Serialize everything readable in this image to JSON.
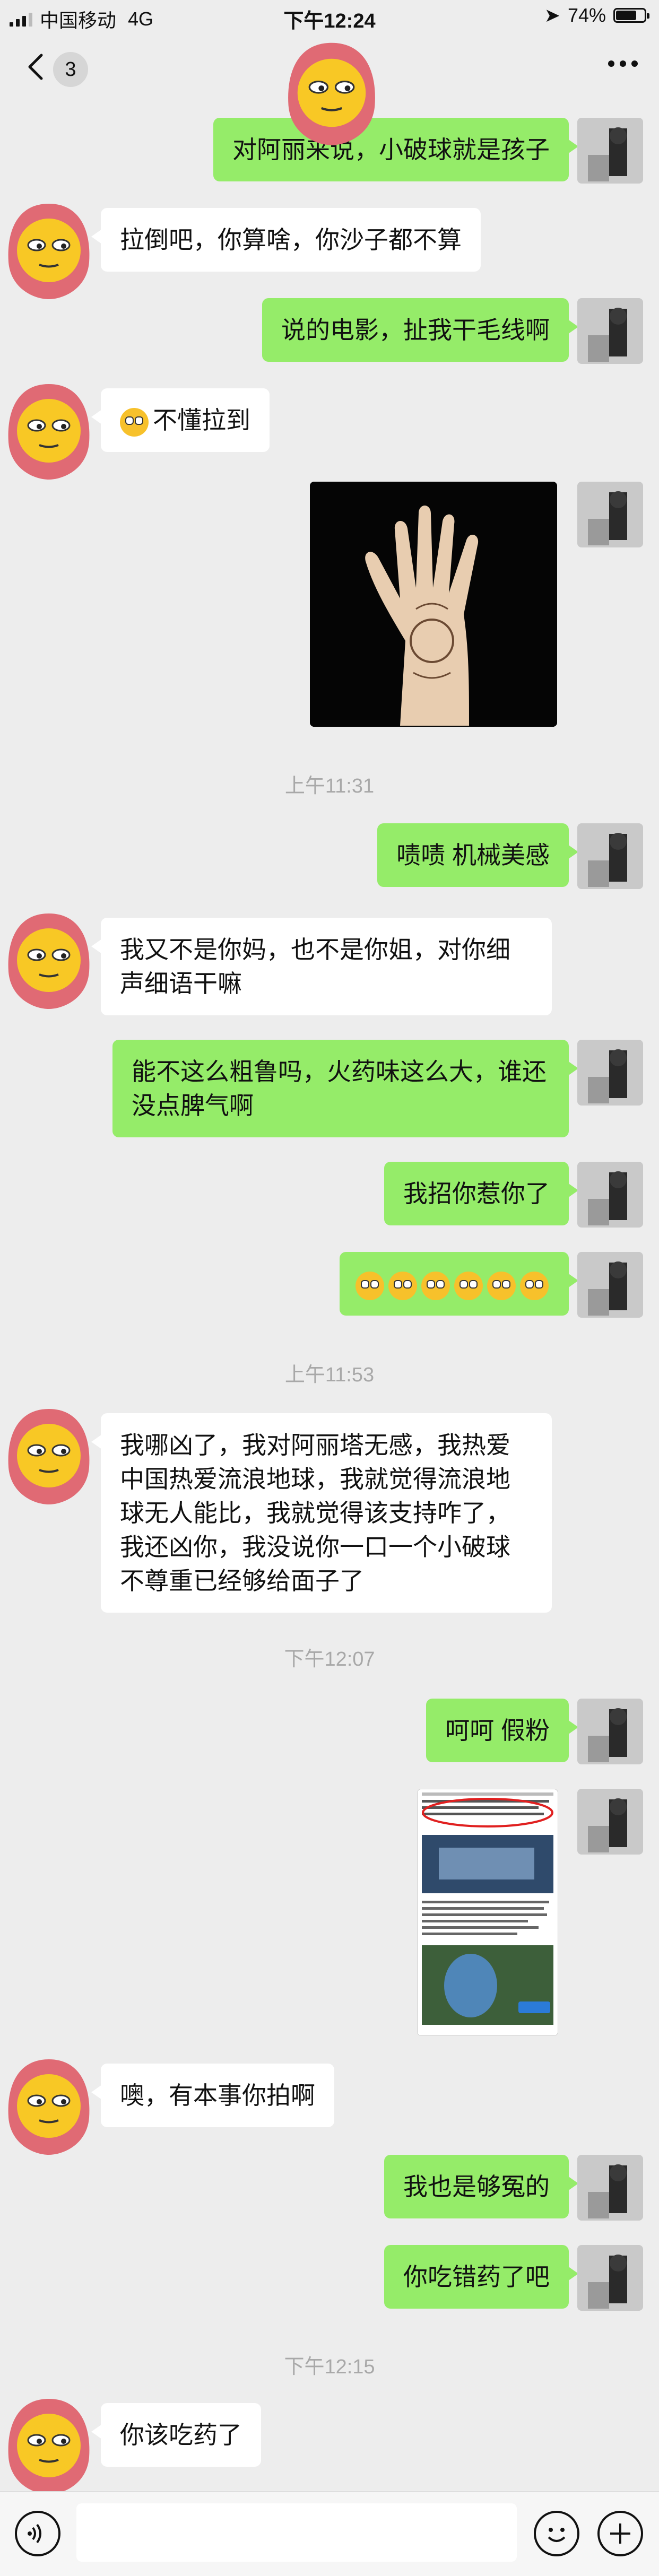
{
  "status_bar": {
    "carrier": "中国移动",
    "network": "4G",
    "time": "下午12:24",
    "battery_pct": "74%",
    "battery_level": 0.74
  },
  "nav": {
    "unread_count": "3"
  },
  "messages": [
    {
      "id": "m1",
      "text": "对阿丽来说，小破球就是孩子"
    },
    {
      "id": "m2",
      "text": "拉倒吧，你算啥，你沙子都不算"
    },
    {
      "id": "m3",
      "text": "说的电影，扯我干毛线啊"
    },
    {
      "id": "m4",
      "text": "不懂拉到"
    },
    {
      "id": "ts1",
      "text": "上午11:31"
    },
    {
      "id": "m5",
      "text": "啧啧 机械美感"
    },
    {
      "id": "m6",
      "text": "我又不是你妈，也不是你姐，对你细声细语干嘛"
    },
    {
      "id": "m7",
      "text": "能不这么粗鲁吗，火药味这么大，谁还没点脾气啊"
    },
    {
      "id": "m8",
      "text": "我招你惹你了"
    },
    {
      "id": "ts2",
      "text": "上午11:53"
    },
    {
      "id": "m10",
      "text": "我哪凶了，我对阿丽塔无感，我热爱中国热爱流浪地球，我就觉得流浪地球无人能比，我就觉得该支持咋了，我还凶你，我没说你一口一个小破球不尊重已经够给面子了"
    },
    {
      "id": "ts3",
      "text": "下午12:07"
    },
    {
      "id": "m11",
      "text": "呵呵 假粉"
    },
    {
      "id": "m13",
      "text": "噢，有本事你拍啊"
    },
    {
      "id": "m14",
      "text": "我也是够冤的"
    },
    {
      "id": "m15",
      "text": "你吃错药了吧"
    },
    {
      "id": "ts4",
      "text": "下午12:15"
    },
    {
      "id": "m16",
      "text": "你该吃药了"
    }
  ],
  "colors": {
    "me_bubble": "#95ec69",
    "them_bubble": "#ffffff",
    "background": "#ededed"
  },
  "icons": [
    "back-arrow-icon",
    "more-icon",
    "voice-icon",
    "emoji-icon",
    "plus-icon"
  ]
}
